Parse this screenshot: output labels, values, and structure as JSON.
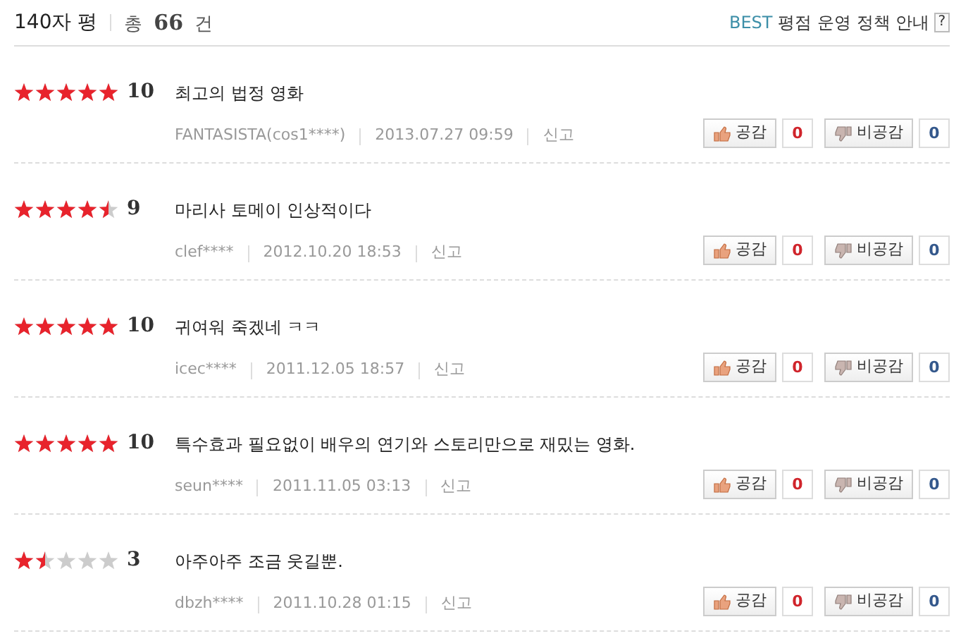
{
  "header": {
    "title": "140자 평",
    "total_prefix": "총",
    "total": "66",
    "total_suffix": "건",
    "policy_best": "BEST",
    "policy_text": "평점 운영 정책 안내",
    "help": "?"
  },
  "reviews": [
    {
      "stars": 5,
      "score": "10",
      "comment": "최고의 법정 영화",
      "author": "FANTASISTA(cos1****)",
      "date": "2013.07.27 09:59",
      "report": "신고",
      "like_label": "공감",
      "like_count": "0",
      "dislike_label": "비공감",
      "dislike_count": "0"
    },
    {
      "stars": 4.5,
      "score": "9",
      "comment": "마리사 토메이 인상적이다",
      "author": "clef****",
      "date": "2012.10.20 18:53",
      "report": "신고",
      "like_label": "공감",
      "like_count": "0",
      "dislike_label": "비공감",
      "dislike_count": "0"
    },
    {
      "stars": 5,
      "score": "10",
      "comment": "귀여워 죽겠네 ㅋㅋ",
      "author": "icec****",
      "date": "2011.12.05 18:57",
      "report": "신고",
      "like_label": "공감",
      "like_count": "0",
      "dislike_label": "비공감",
      "dislike_count": "0"
    },
    {
      "stars": 5,
      "score": "10",
      "comment": "특수효과 필요없이 배우의 연기와 스토리만으로 재밌는 영화.",
      "author": "seun****",
      "date": "2011.11.05 03:13",
      "report": "신고",
      "like_label": "공감",
      "like_count": "0",
      "dislike_label": "비공감",
      "dislike_count": "0"
    },
    {
      "stars": 1.5,
      "score": "3",
      "comment": "아주아주 조금 웃길뿐.",
      "author": "dbzh****",
      "date": "2011.10.28 01:15",
      "report": "신고",
      "like_label": "공감",
      "like_count": "0",
      "dislike_label": "비공감",
      "dislike_count": "0"
    }
  ]
}
